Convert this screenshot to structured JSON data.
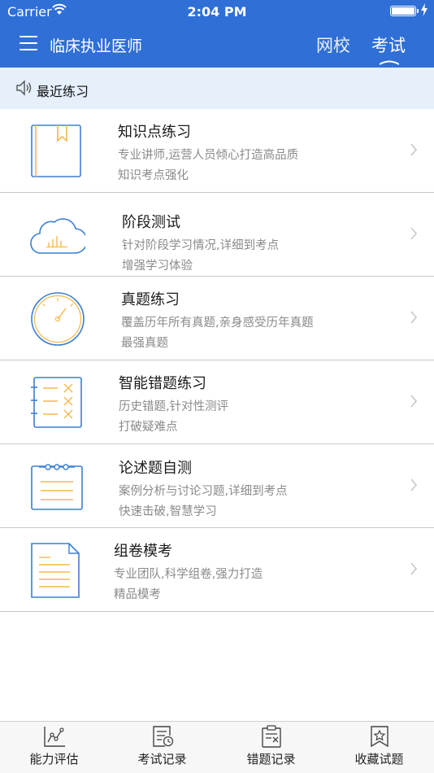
{
  "status_bar": {
    "carrier": "Carrier",
    "time": "2:04 PM",
    "wifi_icon": "wifi-icon",
    "battery_icon": "battery-icon",
    "charging_icon": "bolt-icon"
  },
  "nav": {
    "menu_icon": "hamburger-menu-icon",
    "title": "临床执业医师",
    "tabs": [
      "网校",
      "考试"
    ],
    "active_tab": "考试",
    "bar_color": "#2f6fd6"
  },
  "recent": {
    "icon": "speaker-icon",
    "label": "最近练习",
    "bg_color": "#e5f0fb"
  },
  "items": [
    {
      "title": "知识点练习",
      "line1": "专业讲师,运营人员倾心打造高品质",
      "line2": "知识考点强化",
      "icon": "book-icon"
    },
    {
      "title": "阶段测试",
      "line1": "针对阶段学习情况,详细到考点",
      "line2": "增强学习体验",
      "icon": "cloud-chart-icon"
    },
    {
      "title": "真题练习",
      "line1": "覆盖历年所有真题,亲身感受历年真题",
      "line2": "最强真题",
      "icon": "gauge-icon"
    },
    {
      "title": "智能错题练习",
      "line1": "历史错题,针对性测评",
      "line2": "打破疑难点",
      "icon": "checklist-icon"
    },
    {
      "title": "论述题自测",
      "line1": "案例分析与讨论习题,详细到考点",
      "line2": "快速击破,智慧学习",
      "icon": "notepad-icon"
    },
    {
      "title": "组卷模考",
      "line1": "专业团队,科学组卷,强力打造",
      "line2": "精品模考",
      "icon": "document-icon"
    }
  ],
  "tab_bar": [
    {
      "label": "能力评估",
      "icon": "line-chart-icon"
    },
    {
      "label": "考试记录",
      "icon": "record-clock-icon"
    },
    {
      "label": "错题记录",
      "icon": "clipboard-x-icon"
    },
    {
      "label": "收藏试题",
      "icon": "bookmark-star-icon"
    }
  ],
  "colors": {
    "icon_blue": "#3b7fd4",
    "icon_orange": "#f5b94a",
    "secondary_text": "#8a8a8a"
  }
}
